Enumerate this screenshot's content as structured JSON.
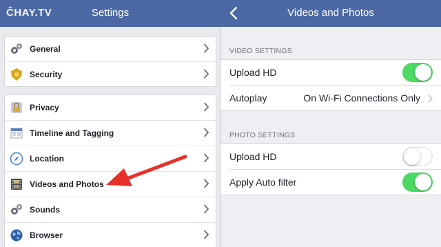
{
  "watermark": "ĈHAY.TV",
  "left": {
    "title": "Settings",
    "groups": [
      [
        {
          "label": "General",
          "icon": "gears-icon"
        },
        {
          "label": "Security",
          "icon": "badge-icon"
        }
      ],
      [
        {
          "label": "Privacy",
          "icon": "lock-icon"
        },
        {
          "label": "Timeline and Tagging",
          "icon": "timeline-icon"
        },
        {
          "label": "Location",
          "icon": "compass-icon"
        },
        {
          "label": "Videos and Photos",
          "icon": "film-icon"
        },
        {
          "label": "Sounds",
          "icon": "gears-icon"
        },
        {
          "label": "Browser",
          "icon": "globe-icon"
        }
      ]
    ]
  },
  "right": {
    "title": "Videos and Photos",
    "video_section": {
      "header": "VIDEO SETTINGS",
      "rows": [
        {
          "label": "Upload HD",
          "toggle": true
        },
        {
          "label": "Autoplay",
          "value": "On Wi-Fi Connections Only"
        }
      ]
    },
    "photo_section": {
      "header": "PHOTO SETTINGS",
      "rows": [
        {
          "label": "Upload HD",
          "toggle": false
        },
        {
          "label": "Apply Auto filter",
          "toggle": true
        }
      ]
    }
  },
  "colors": {
    "header": "#4c69a6",
    "toggle_on": "#4cd964",
    "arrow": "#e8302a"
  }
}
